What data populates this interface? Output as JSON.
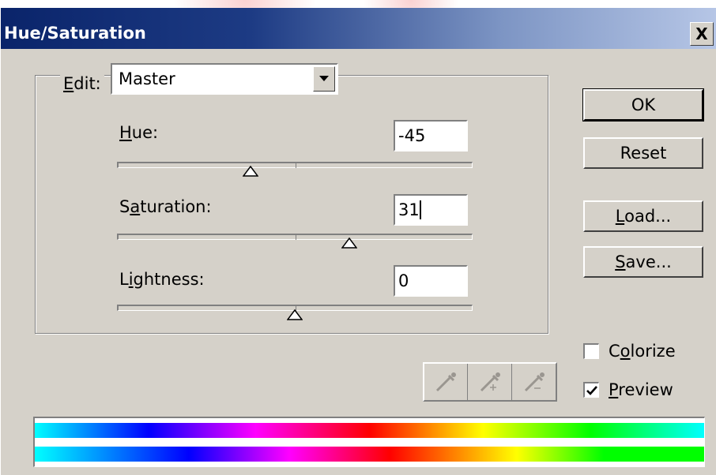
{
  "window": {
    "title": "Hue/Saturation",
    "close_glyph": "X"
  },
  "edit": {
    "label": "Edit:",
    "mnemonic": "E",
    "label_rest": "dit:",
    "selected": "Master"
  },
  "sliders": [
    {
      "id": "hue",
      "label_pre": "",
      "mnemonic": "H",
      "label_post": "ue:",
      "value": "-45",
      "range": [
        -180,
        180
      ],
      "position": -45
    },
    {
      "id": "saturation",
      "label_pre": "S",
      "mnemonic": "a",
      "label_post": "turation:",
      "value": "31",
      "range": [
        -100,
        100
      ],
      "position": 31
    },
    {
      "id": "lightness",
      "label_pre": "L",
      "mnemonic": "i",
      "label_post": "ghtness:",
      "value": "0",
      "range": [
        -100,
        100
      ],
      "position": 0
    }
  ],
  "buttons": {
    "ok": "OK",
    "reset": "Reset",
    "load_mnemonic": "L",
    "load_rest": "oad...",
    "save_mnemonic": "S",
    "save_rest": "ave..."
  },
  "checkboxes": {
    "colorize": {
      "pre": "C",
      "mnemonic": "o",
      "post": "lorize",
      "checked": false
    },
    "preview": {
      "pre": "",
      "mnemonic": "P",
      "post": "review",
      "checked": true
    }
  },
  "eyedroppers": [
    "eyedropper-icon",
    "eyedropper-plus-icon",
    "eyedropper-minus-icon"
  ],
  "colors": {
    "title_bar_start": "#0a246a",
    "title_bar_end": "#b6c6e6",
    "dialog_face": "#d5d1c9"
  }
}
